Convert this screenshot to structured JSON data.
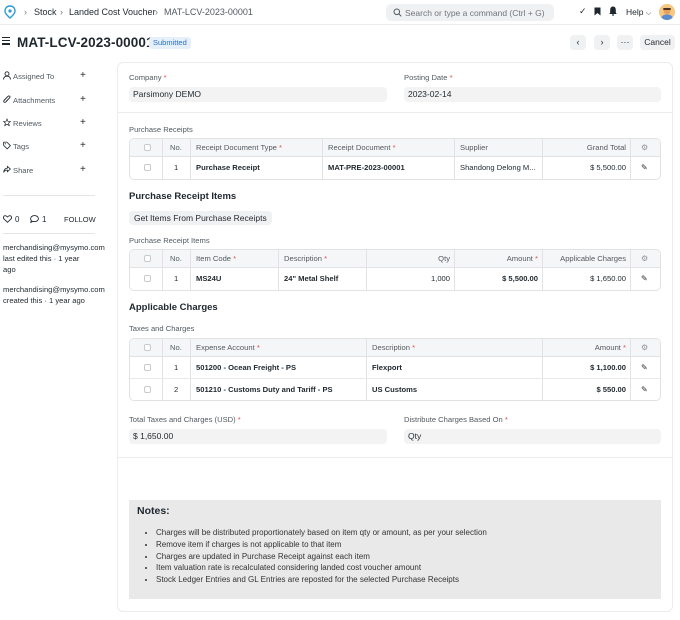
{
  "navbar": {
    "breadcrumbs": [
      "Stock",
      "Landed Cost Voucher",
      "MAT-LCV-2023-00001"
    ],
    "search_placeholder": "Search or type a command (Ctrl + G)",
    "help_label": "Help"
  },
  "page": {
    "title": "MAT-LCV-2023-00001",
    "status": "Submitted",
    "cancel_label": "Cancel",
    "more_label": "···"
  },
  "sidebar": {
    "items": [
      {
        "label": "Assigned To",
        "icon": "user-icon"
      },
      {
        "label": "Attachments",
        "icon": "paperclip-icon"
      },
      {
        "label": "Reviews",
        "icon": "star-icon"
      },
      {
        "label": "Tags",
        "icon": "tag-icon"
      },
      {
        "label": "Share",
        "icon": "share-icon"
      }
    ],
    "likes": "0",
    "comments": "1",
    "follow_label": "FOLLOW",
    "activity": [
      {
        "user": "merchandising@mysymo.com",
        "text": "last edited this · 1 year ago"
      },
      {
        "user": "merchandising@mysymo.com",
        "text": "created this · 1 year ago"
      }
    ]
  },
  "form": {
    "company_label": "Company",
    "company_value": "Parsimony DEMO",
    "posting_date_label": "Posting Date",
    "posting_date_value": "2023-02-14",
    "purchase_receipts_label": "Purchase Receipts",
    "purchase_receipt_items_title": "Purchase Receipt Items",
    "get_items_label": "Get Items From Purchase Receipts",
    "purchase_receipt_items_label": "Purchase Receipt Items",
    "applicable_charges_title": "Applicable Charges",
    "taxes_and_charges_label": "Taxes and Charges",
    "total_taxes_label": "Total Taxes and Charges (USD)",
    "total_taxes_value": "$ 1,650.00",
    "distribute_label": "Distribute Charges Based On",
    "distribute_value": "Qty"
  },
  "receipts_table": {
    "headers": [
      "No.",
      "Receipt Document Type",
      "Receipt Document",
      "Supplier",
      "Grand Total"
    ],
    "rows": [
      {
        "no": "1",
        "type": "Purchase Receipt",
        "doc": "MAT-PRE-2023-00001",
        "supplier": "Shandong Delong M...",
        "total": "$ 5,500.00"
      }
    ]
  },
  "items_table": {
    "headers": [
      "No.",
      "Item Code",
      "Description",
      "Qty",
      "Amount",
      "Applicable Charges"
    ],
    "rows": [
      {
        "no": "1",
        "item_code": "MS24U",
        "description": "24\" Metal Shelf",
        "qty": "1,000",
        "amount": "$ 5,500.00",
        "charges": "$ 1,650.00"
      }
    ]
  },
  "charges_table": {
    "headers": [
      "No.",
      "Expense Account",
      "Description",
      "Amount"
    ],
    "rows": [
      {
        "no": "1",
        "account": "501200 - Ocean Freight - PS",
        "description": "Flexport",
        "amount": "$ 1,100.00"
      },
      {
        "no": "2",
        "account": "501210 - Customs Duty and Tariff - PS",
        "description": "US Customs",
        "amount": "$ 550.00"
      }
    ]
  },
  "notes": {
    "title": "Notes:",
    "items": [
      "Charges will be distributed proportionately based on item qty or amount, as per your selection",
      "Remove item if charges is not applicable to that item",
      "Charges are updated in Purchase Receipt against each item",
      "Item valuation rate is recalculated considering landed cost voucher amount",
      "Stock Ledger Entries and GL Entries are reposted for the selected Purchase Receipts"
    ]
  }
}
